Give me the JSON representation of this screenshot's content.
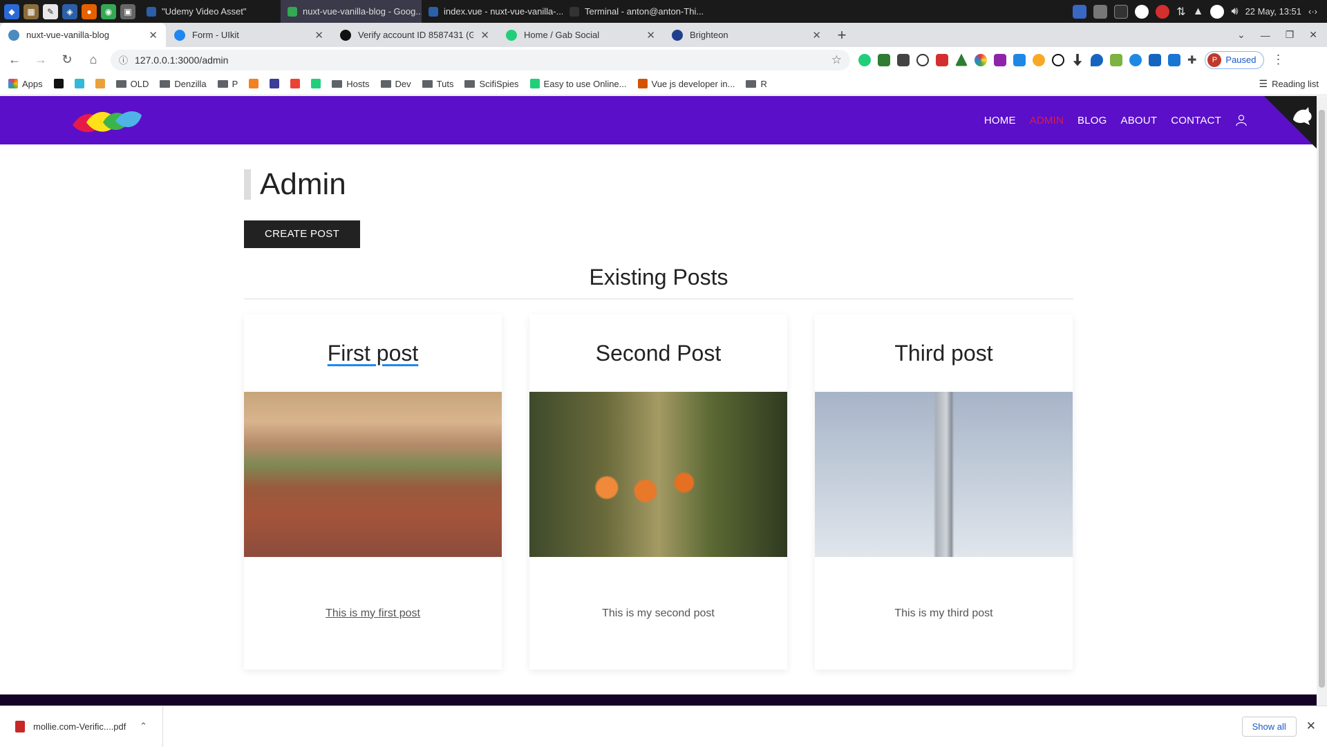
{
  "taskbar": {
    "tasks": [
      {
        "label": "\"Udemy Video Asset\"",
        "active": false
      },
      {
        "label": "nuxt-vue-vanilla-blog - Goog...",
        "active": true
      },
      {
        "label": "index.vue - nuxt-vue-vanilla-...",
        "active": false
      },
      {
        "label": "Terminal - anton@anton-Thi...",
        "active": false
      }
    ],
    "datetime": "22 May, 13:51"
  },
  "browser": {
    "tabs": [
      {
        "title": "nuxt-vue-vanilla-blog",
        "active": true,
        "color": "#4b8bbe"
      },
      {
        "title": "Form - UIkit",
        "active": false,
        "color": "#1e87f0"
      },
      {
        "title": "Verify account ID 8587431 (GB",
        "active": false,
        "color": "#111111"
      },
      {
        "title": "Home / Gab Social",
        "active": false,
        "color": "#21cf7a"
      },
      {
        "title": "Brighteon",
        "active": false,
        "color": "#1e3f8c"
      }
    ],
    "new_tab": "+",
    "url": "127.0.0.1:3000/admin",
    "profile_initial": "P",
    "profile_status": "Paused",
    "bookmarks": [
      {
        "label": "Apps",
        "type": "grid"
      },
      {
        "label": "",
        "type": "icon",
        "color": "#111111"
      },
      {
        "label": "",
        "type": "icon",
        "color": "#35b8d6"
      },
      {
        "label": "",
        "type": "icon",
        "color": "#e9a23b"
      },
      {
        "label": "OLD",
        "type": "folder"
      },
      {
        "label": "Denzilla",
        "type": "folder"
      },
      {
        "label": "P",
        "type": "folder"
      },
      {
        "label": "",
        "type": "icon",
        "color": "#f48024"
      },
      {
        "label": "",
        "type": "icon",
        "color": "#3b3b98"
      },
      {
        "label": "",
        "type": "icon",
        "color": "#ea4335"
      },
      {
        "label": "",
        "type": "icon",
        "color": "#21cf7a"
      },
      {
        "label": "Hosts",
        "type": "folder"
      },
      {
        "label": "Dev",
        "type": "folder"
      },
      {
        "label": "Tuts",
        "type": "folder"
      },
      {
        "label": "ScifiSpies",
        "type": "folder"
      },
      {
        "label": "Easy to use Online...",
        "type": "icon",
        "color": "#21cf7a"
      },
      {
        "label": "Vue js developer in...",
        "type": "icon",
        "color": "#d35400"
      },
      {
        "label": "R",
        "type": "folder"
      }
    ],
    "reading_list": "Reading list"
  },
  "site": {
    "nav": {
      "home": "HOME",
      "admin": "ADMIN",
      "blog": "BLOG",
      "about": "ABOUT",
      "contact": "CONTACT"
    },
    "page_title": "Admin",
    "create_button": "CREATE POST",
    "section_title": "Existing Posts",
    "posts": [
      {
        "title": "First post",
        "text": "This is my first post",
        "image": "autumn-path"
      },
      {
        "title": "Second Post",
        "text": "This is my second post",
        "image": "tulips"
      },
      {
        "title": "Third post",
        "text": "This is my third post",
        "image": "tower-sky"
      }
    ],
    "colors": {
      "header": "#5b0fc8",
      "active_link": "#e31b3c",
      "button": "#222222"
    }
  },
  "downloads": {
    "file": "mollie.com-Verific....pdf",
    "show_all": "Show all"
  }
}
